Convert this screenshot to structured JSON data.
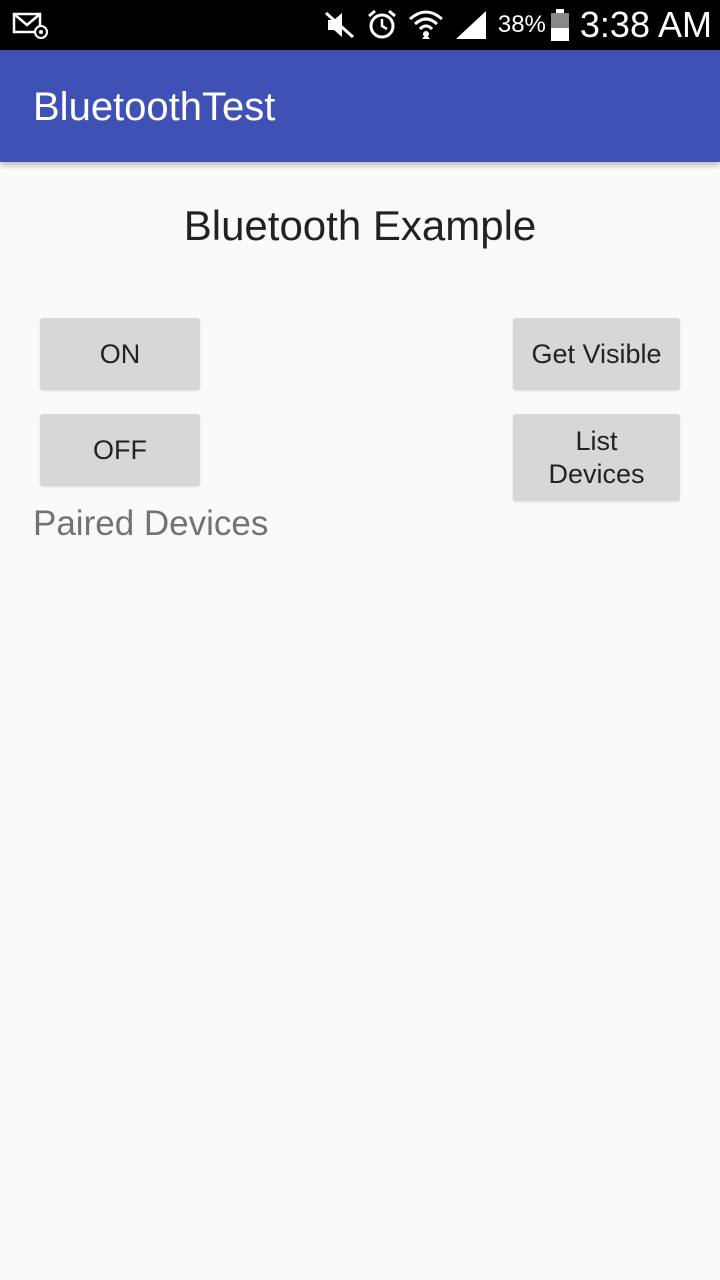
{
  "status_bar": {
    "icons": [
      "email-notification-icon",
      "mute-icon",
      "alarm-icon",
      "wifi-icon",
      "signal-icon",
      "battery-icon"
    ],
    "battery_percent": "38%",
    "time": "3:38 AM"
  },
  "app_bar": {
    "title": "BluetoothTest",
    "color": "#3f51b5"
  },
  "main": {
    "heading": "Bluetooth Example",
    "buttons": {
      "on": "ON",
      "off": "OFF",
      "get_visible": "Get Visible",
      "list_devices": "List Devices"
    },
    "paired_devices_label": "Paired Devices"
  }
}
